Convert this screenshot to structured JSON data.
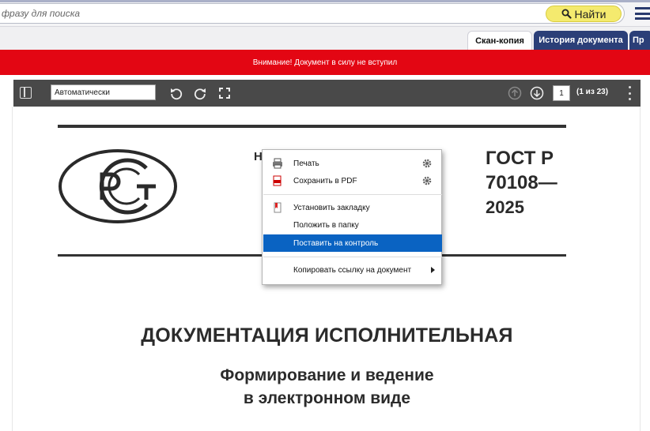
{
  "search": {
    "placeholder": "фразу для поиска",
    "button_label": "Найти"
  },
  "tabs": [
    {
      "label": "Скан-копия",
      "active": true
    },
    {
      "label": "История документа",
      "active": false
    },
    {
      "label": "Пр",
      "active": false
    }
  ],
  "banner": {
    "text": "Внимание! Документ в силу не вступил"
  },
  "pdf_toolbar": {
    "zoom_value": "Автоматически",
    "page_current": "1",
    "page_count": "(1 из 23)"
  },
  "document": {
    "partial_heading": "Н",
    "gost_line1": "ГОСТ Р",
    "gost_line2": "70108—",
    "gost_line3": "2025",
    "title": "ДОКУМЕНТАЦИЯ ИСПОЛНИТЕЛЬНАЯ",
    "subtitle_line1": "Формирование и ведение",
    "subtitle_line2": "в электронном виде"
  },
  "context_menu": {
    "items": [
      {
        "label": "Печать",
        "icon": "printer-icon",
        "has_settings": true
      },
      {
        "label": "Сохранить в PDF",
        "icon": "pdf-icon",
        "has_settings": true
      },
      {
        "label": "Установить закладку",
        "icon": "bookmark-icon"
      },
      {
        "label": "Положить в папку"
      },
      {
        "label": "Поставить на контроль",
        "selected": true
      },
      {
        "label": "Копировать ссылку на документ",
        "has_submenu": true
      }
    ]
  },
  "colors": {
    "banner_red": "#e30613",
    "tab_dark": "#2b3f78",
    "search_button": "#f4ea6e",
    "menu_selected": "#0a63c2",
    "toolbar": "#494949"
  }
}
